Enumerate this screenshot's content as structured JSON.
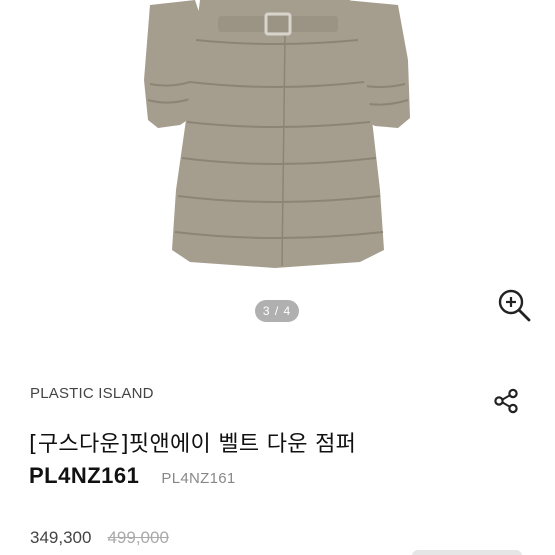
{
  "gallery": {
    "page_indicator": "3 / 4",
    "image_icon": "puffer-coat-photo",
    "zoom_icon": "zoom-in-icon"
  },
  "product": {
    "brand": "PLASTIC ISLAND",
    "title": "[구스다운]핏앤에이 벨트 다운 점퍼",
    "model_code": "PL4NZ161",
    "model_code_sub": "PL4NZ161",
    "sale_price": "349,300",
    "original_price": "499,000",
    "share_icon": "share-icon"
  },
  "colors": {
    "coat": "#a59e8f",
    "coat_shadow": "#8c8576",
    "indicator_bg": "#6e6e6e",
    "text_primary": "#111111",
    "text_secondary": "#444444",
    "text_muted": "#888888"
  }
}
